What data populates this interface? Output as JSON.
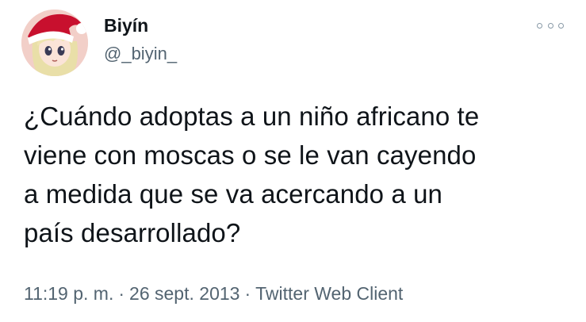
{
  "author": {
    "display_name": "Biyín",
    "handle": "@_biyin_"
  },
  "tweet": {
    "text": "¿Cuándo adoptas a un niño africano te\nviene con moscas o se le van cayendo\na medida que se va acercando a un\npaís desarrollado?",
    "time": "11:19 p. m.",
    "separator": "·",
    "date": "26 sept. 2013",
    "source": "Twitter Web Client"
  },
  "icons": {
    "avatar": "santa-hat-anime-girl-avatar",
    "more": "more-options-icon"
  },
  "colors": {
    "text": "#0f1419",
    "secondary": "#536471",
    "hat_red": "#c8102e"
  }
}
